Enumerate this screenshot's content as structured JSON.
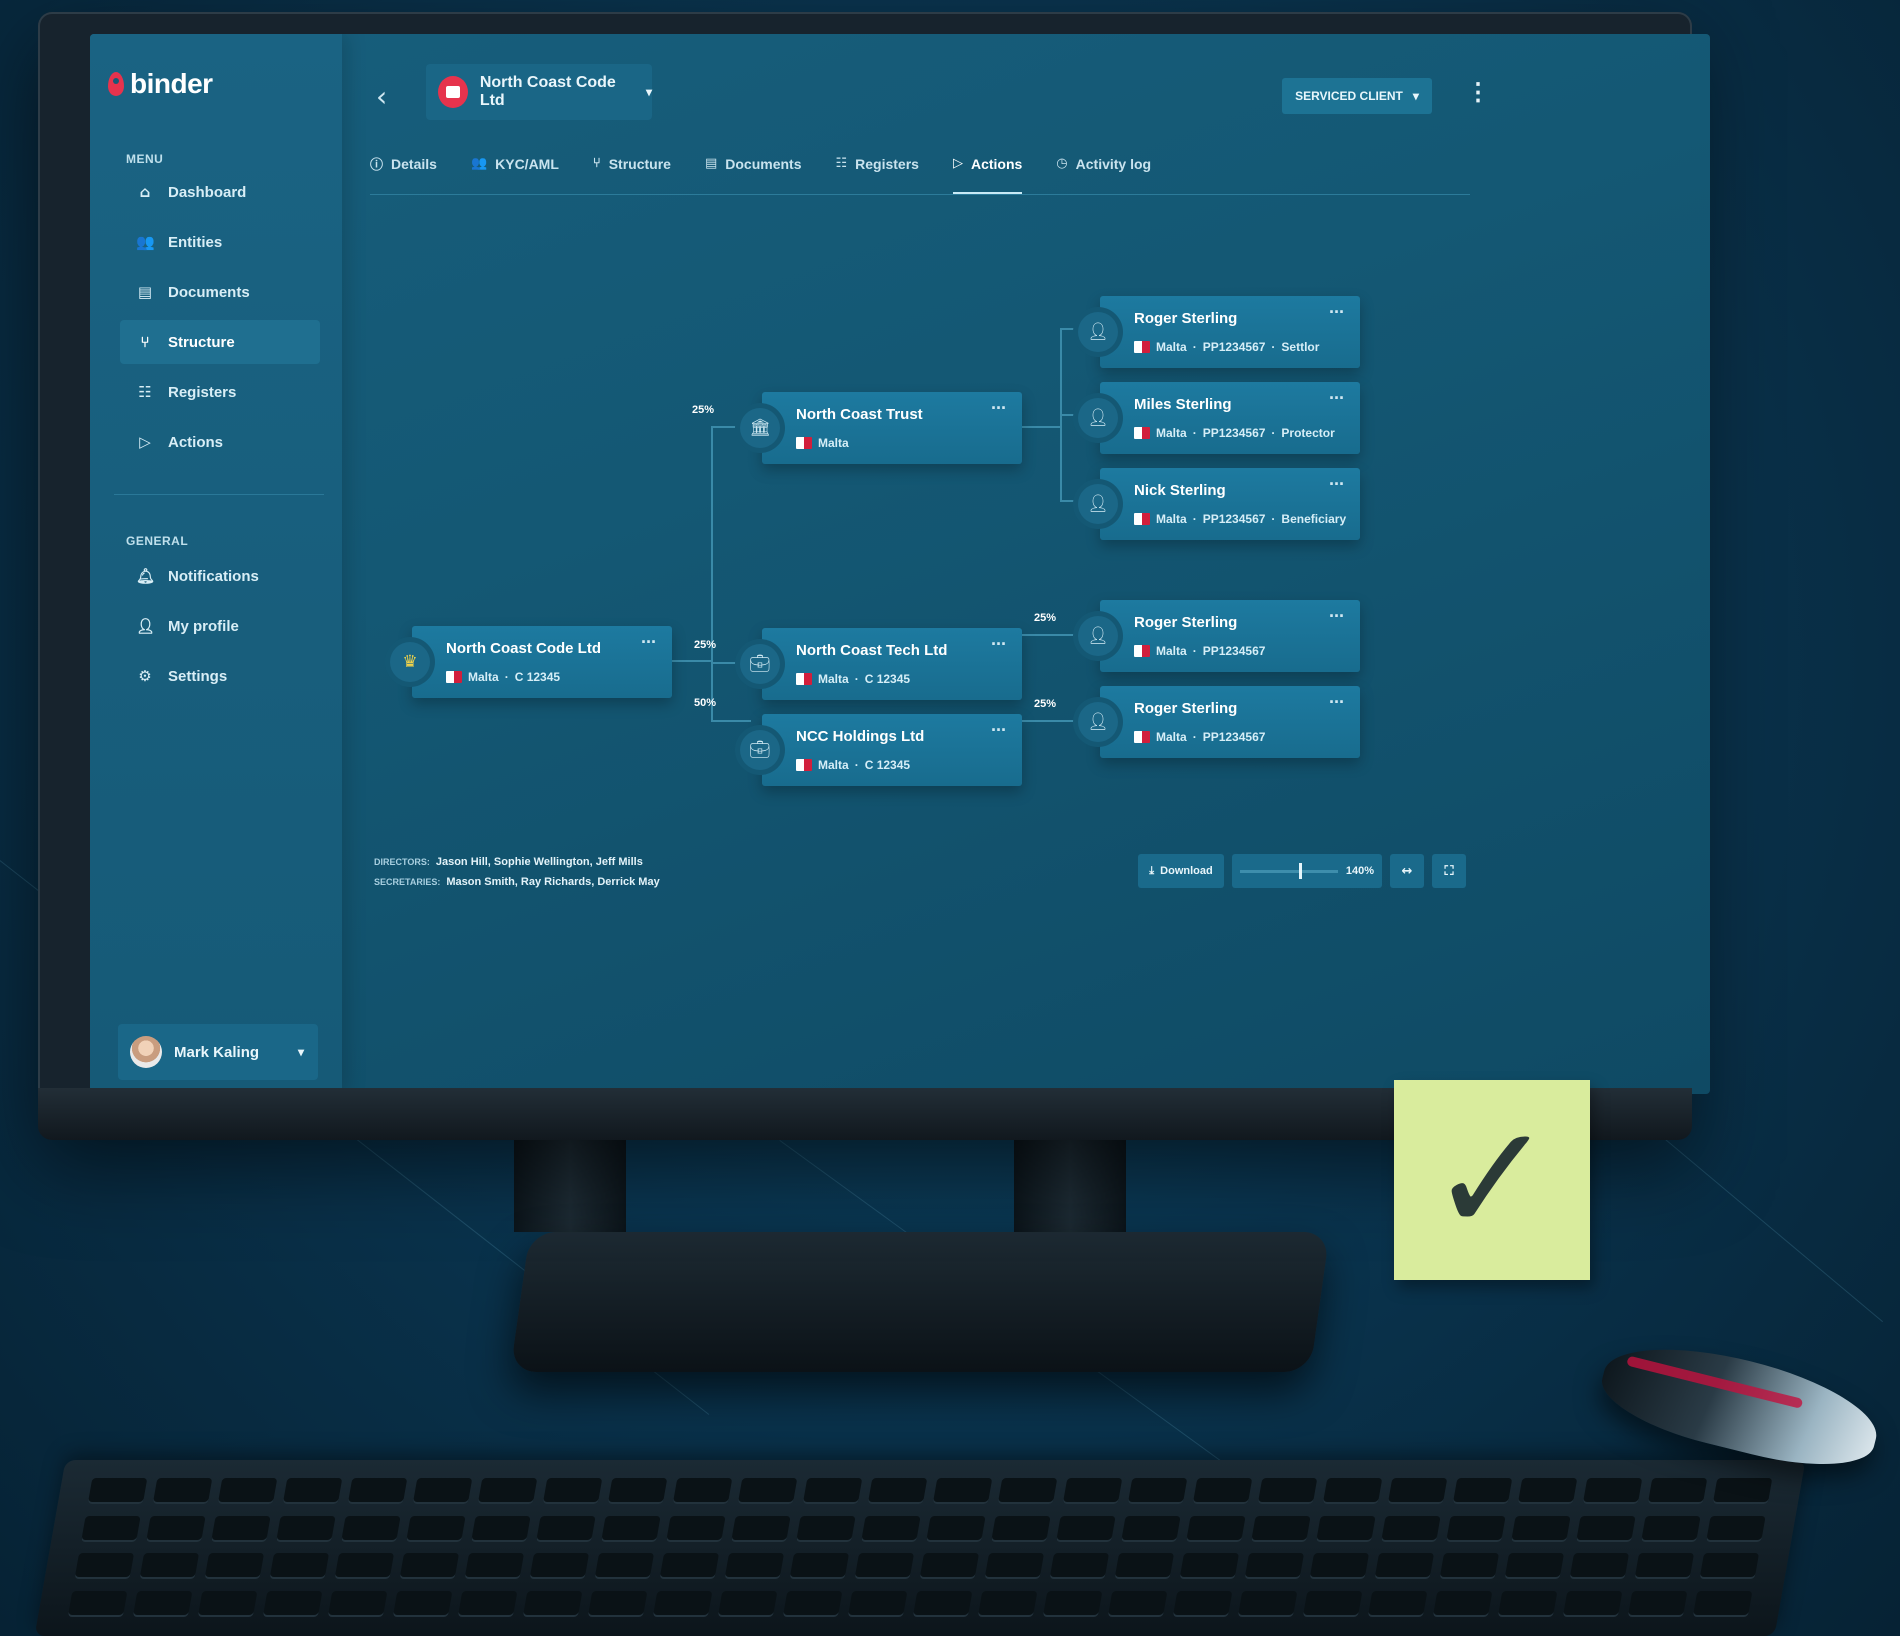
{
  "app": {
    "logo_text": "binder"
  },
  "sidebar": {
    "menu_label": "MENU",
    "menu": [
      {
        "label": "Dashboard",
        "icon": "home-icon"
      },
      {
        "label": "Entities",
        "icon": "users-icon"
      },
      {
        "label": "Documents",
        "icon": "document-icon"
      },
      {
        "label": "Structure",
        "icon": "structure-icon",
        "active": true
      },
      {
        "label": "Registers",
        "icon": "registers-icon"
      },
      {
        "label": "Actions",
        "icon": "play-icon"
      }
    ],
    "general_label": "GENERAL",
    "general": [
      {
        "label": "Notifications",
        "icon": "bell-icon"
      },
      {
        "label": "My profile",
        "icon": "user-icon"
      },
      {
        "label": "Settings",
        "icon": "gear-icon"
      }
    ],
    "user": {
      "name": "Mark Kaling"
    }
  },
  "header": {
    "entity": "North Coast Code Ltd",
    "status": "SERVICED CLIENT"
  },
  "tabs": [
    {
      "label": "Details",
      "icon": "info-icon"
    },
    {
      "label": "KYC/AML",
      "icon": "kyc-icon"
    },
    {
      "label": "Structure",
      "icon": "structure-icon"
    },
    {
      "label": "Documents",
      "icon": "document-icon"
    },
    {
      "label": "Registers",
      "icon": "registers-icon"
    },
    {
      "label": "Actions",
      "icon": "play-icon",
      "active": true
    },
    {
      "label": "Activity log",
      "icon": "clock-icon"
    }
  ],
  "structure": {
    "root": {
      "name": "North Coast Code Ltd",
      "country": "Malta",
      "reg": "C 12345"
    },
    "trust": {
      "name": "North Coast Trust",
      "country": "Malta",
      "pct": "25%"
    },
    "tech": {
      "name": "North Coast Tech Ltd",
      "country": "Malta",
      "reg": "C 12345",
      "pct": "25%"
    },
    "holdings": {
      "name": "NCC Holdings Ltd",
      "country": "Malta",
      "reg": "C 12345",
      "pct": "50%"
    },
    "trust_people": [
      {
        "name": "Roger Sterling",
        "country": "Malta",
        "id": "PP1234567",
        "role": "Settlor"
      },
      {
        "name": "Miles Sterling",
        "country": "Malta",
        "id": "PP1234567",
        "role": "Protector"
      },
      {
        "name": "Nick Sterling",
        "country": "Malta",
        "id": "PP1234567",
        "role": "Beneficiary"
      }
    ],
    "tech_owner": {
      "name": "Roger Sterling",
      "country": "Malta",
      "id": "PP1234567",
      "pct": "25%"
    },
    "holdings_owner": {
      "name": "Roger Sterling",
      "country": "Malta",
      "id": "PP1234567",
      "pct": "25%"
    },
    "sep": "·"
  },
  "footer": {
    "directors_label": "DIRECTORS:",
    "directors": "Jason Hill, Sophie Wellington, Jeff Mills",
    "secretaries_label": "SECRETARIES:",
    "secretaries": "Mason Smith, Ray Richards, Derrick May",
    "download": "Download",
    "zoom": "140%",
    "zoom_level": 0.6
  },
  "sticky_note": {
    "mark": "✓"
  }
}
